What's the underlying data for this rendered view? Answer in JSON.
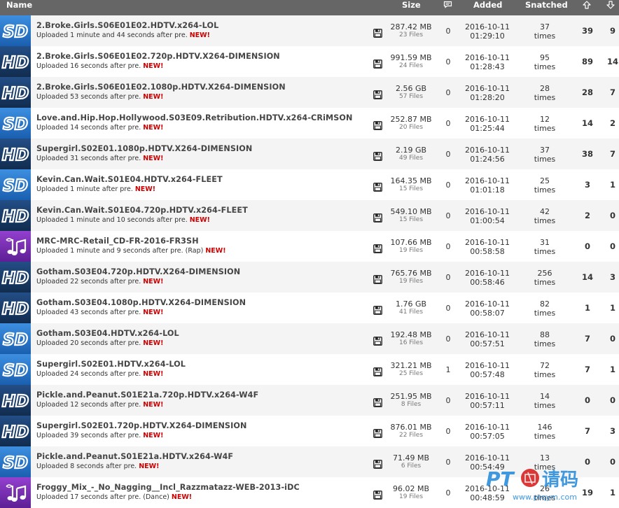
{
  "header": {
    "name": "Name",
    "size": "Size",
    "comments_icon": "comment-icon",
    "added": "Added",
    "snatched": "Snatched",
    "seeders_icon": "arrow-up-icon",
    "leechers_icon": "arrow-down-icon"
  },
  "colors": {
    "header_bg": "#666666",
    "sd_blue": "#1e6fc8",
    "hd_navy": "#15375f",
    "music_purple": "#7a2fb5",
    "new_red": "#cc0000"
  },
  "rows": [
    {
      "cat": "SD",
      "cat_icon": "sd-icon",
      "name": "2.Broke.Girls.S06E01E02.HDTV.x264-LOL",
      "uploaded": "Uploaded 1 minute and 44 seconds after pre.",
      "new": "NEW!",
      "size": "287.42 MB",
      "files": "23 Files",
      "comments": "0",
      "date": "2016-10-11",
      "time": "01:29:10",
      "snatched": "37",
      "times": "times",
      "seeders": "39",
      "leechers": "9"
    },
    {
      "cat": "HD",
      "cat_icon": "hd-icon",
      "name": "2.Broke.Girls.S06E01E02.720p.HDTV.X264-DIMENSION",
      "uploaded": "Uploaded 16 seconds after pre.",
      "new": "NEW!",
      "size": "991.59 MB",
      "files": "24 Files",
      "comments": "0",
      "date": "2016-10-11",
      "time": "01:28:43",
      "snatched": "95",
      "times": "times",
      "seeders": "89",
      "leechers": "14"
    },
    {
      "cat": "HD",
      "cat_icon": "hd-icon",
      "name": "2.Broke.Girls.S06E01E02.1080p.HDTV.X264-DIMENSION",
      "uploaded": "Uploaded 53 seconds after pre.",
      "new": "NEW!",
      "size": "2.56 GB",
      "files": "57 Files",
      "comments": "0",
      "date": "2016-10-11",
      "time": "01:28:20",
      "snatched": "28",
      "times": "times",
      "seeders": "28",
      "leechers": "7"
    },
    {
      "cat": "SD",
      "cat_icon": "sd-icon",
      "name": "Love.and.Hip.Hop.Hollywood.S03E09.Retribution.HDTV.x264-CRiMSON",
      "uploaded": "Uploaded 14 seconds after pre.",
      "new": "NEW!",
      "size": "252.87 MB",
      "files": "20 Files",
      "comments": "0",
      "date": "2016-10-11",
      "time": "01:25:44",
      "snatched": "12",
      "times": "times",
      "seeders": "14",
      "leechers": "2"
    },
    {
      "cat": "HD",
      "cat_icon": "hd-icon",
      "name": "Supergirl.S02E01.1080p.HDTV.X264-DIMENSION",
      "uploaded": "Uploaded 31 seconds after pre.",
      "new": "NEW!",
      "size": "2.19 GB",
      "files": "49 Files",
      "comments": "0",
      "date": "2016-10-11",
      "time": "01:24:56",
      "snatched": "37",
      "times": "times",
      "seeders": "38",
      "leechers": "7"
    },
    {
      "cat": "SD",
      "cat_icon": "sd-icon",
      "name": "Kevin.Can.Wait.S01E04.HDTV.x264-FLEET",
      "uploaded": "Uploaded 1 minute after pre.",
      "new": "NEW!",
      "size": "164.35 MB",
      "files": "15 Files",
      "comments": "0",
      "date": "2016-10-11",
      "time": "01:01:18",
      "snatched": "25",
      "times": "times",
      "seeders": "3",
      "leechers": "1"
    },
    {
      "cat": "HD",
      "cat_icon": "hd-icon",
      "name": "Kevin.Can.Wait.S01E04.720p.HDTV.x264-FLEET",
      "uploaded": "Uploaded 1 minute and 10 seconds after pre.",
      "new": "NEW!",
      "size": "549.10 MB",
      "files": "15 Files",
      "comments": "0",
      "date": "2016-10-11",
      "time": "01:00:54",
      "snatched": "42",
      "times": "times",
      "seeders": "2",
      "leechers": "0"
    },
    {
      "cat": "MUSIC",
      "cat_icon": "music-icon",
      "name": "MRC-MRC-Retail_CD-FR-2016-FR3SH",
      "uploaded": "Uploaded 1 minute and 9 seconds after pre. (Rap)",
      "new": "NEW!",
      "size": "107.66 MB",
      "files": "19 Files",
      "comments": "0",
      "date": "2016-10-11",
      "time": "00:58:58",
      "snatched": "31",
      "times": "times",
      "seeders": "0",
      "leechers": "0"
    },
    {
      "cat": "HD",
      "cat_icon": "hd-icon",
      "name": "Gotham.S03E04.720p.HDTV.X264-DIMENSION",
      "uploaded": "Uploaded 22 seconds after pre.",
      "new": "NEW!",
      "size": "765.76 MB",
      "files": "19 Files",
      "comments": "0",
      "date": "2016-10-11",
      "time": "00:58:46",
      "snatched": "256",
      "times": "times",
      "seeders": "14",
      "leechers": "3"
    },
    {
      "cat": "HD",
      "cat_icon": "hd-icon",
      "name": "Gotham.S03E04.1080p.HDTV.X264-DIMENSION",
      "uploaded": "Uploaded 43 seconds after pre.",
      "new": "NEW!",
      "size": "1.76 GB",
      "files": "41 Files",
      "comments": "0",
      "date": "2016-10-11",
      "time": "00:58:07",
      "snatched": "82",
      "times": "times",
      "seeders": "1",
      "leechers": "1"
    },
    {
      "cat": "SD",
      "cat_icon": "sd-icon",
      "name": "Gotham.S03E04.HDTV.x264-LOL",
      "uploaded": "Uploaded 20 seconds after pre.",
      "new": "NEW!",
      "size": "192.48 MB",
      "files": "16 Files",
      "comments": "0",
      "date": "2016-10-11",
      "time": "00:57:51",
      "snatched": "88",
      "times": "times",
      "seeders": "7",
      "leechers": "0"
    },
    {
      "cat": "SD",
      "cat_icon": "sd-icon",
      "name": "Supergirl.S02E01.HDTV.x264-LOL",
      "uploaded": "Uploaded 24 seconds after pre.",
      "new": "NEW!",
      "size": "321.21 MB",
      "files": "25 Files",
      "comments": "1",
      "date": "2016-10-11",
      "time": "00:57:48",
      "snatched": "72",
      "times": "times",
      "seeders": "7",
      "leechers": "1"
    },
    {
      "cat": "HD",
      "cat_icon": "hd-icon",
      "name": "Pickle.and.Peanut.S01E21a.720p.HDTV.x264-W4F",
      "uploaded": "Uploaded 12 seconds after pre.",
      "new": "NEW!",
      "size": "251.95 MB",
      "files": "8 Files",
      "comments": "0",
      "date": "2016-10-11",
      "time": "00:57:11",
      "snatched": "14",
      "times": "times",
      "seeders": "0",
      "leechers": "0"
    },
    {
      "cat": "HD",
      "cat_icon": "hd-icon",
      "name": "Supergirl.S02E01.720p.HDTV.X264-DIMENSION",
      "uploaded": "Uploaded 39 seconds after pre.",
      "new": "NEW!",
      "size": "876.01 MB",
      "files": "22 Files",
      "comments": "0",
      "date": "2016-10-11",
      "time": "00:57:05",
      "snatched": "146",
      "times": "times",
      "seeders": "7",
      "leechers": "3"
    },
    {
      "cat": "SD",
      "cat_icon": "sd-icon",
      "name": "Pickle.and.Peanut.S01E21a.HDTV.x264-W4F",
      "uploaded": "Uploaded 8 seconds after pre.",
      "new": "NEW!",
      "size": "71.49 MB",
      "files": "6 Files",
      "comments": "0",
      "date": "2016-10-11",
      "time": "00:54:49",
      "snatched": "13",
      "times": "times",
      "seeders": "0",
      "leechers": "0"
    },
    {
      "cat": "MUSIC",
      "cat_icon": "music-icon",
      "name": "Froggy_Mix_-_No_Nagging__Incl_Razzmatazz-WEB-2013-iDC",
      "uploaded": "Uploaded 17 seconds after pre. (Dance)",
      "new": "NEW!",
      "size": "96.02 MB",
      "files": "19 Files",
      "comments": "0",
      "date": "2016-10-11",
      "time": "00:48:59",
      "snatched": "26",
      "times": "times",
      "seeders": "19",
      "leechers": "1"
    }
  ],
  "watermark": {
    "latin": "PT",
    "cjk": "请码",
    "url": "www.ptqym.com"
  }
}
